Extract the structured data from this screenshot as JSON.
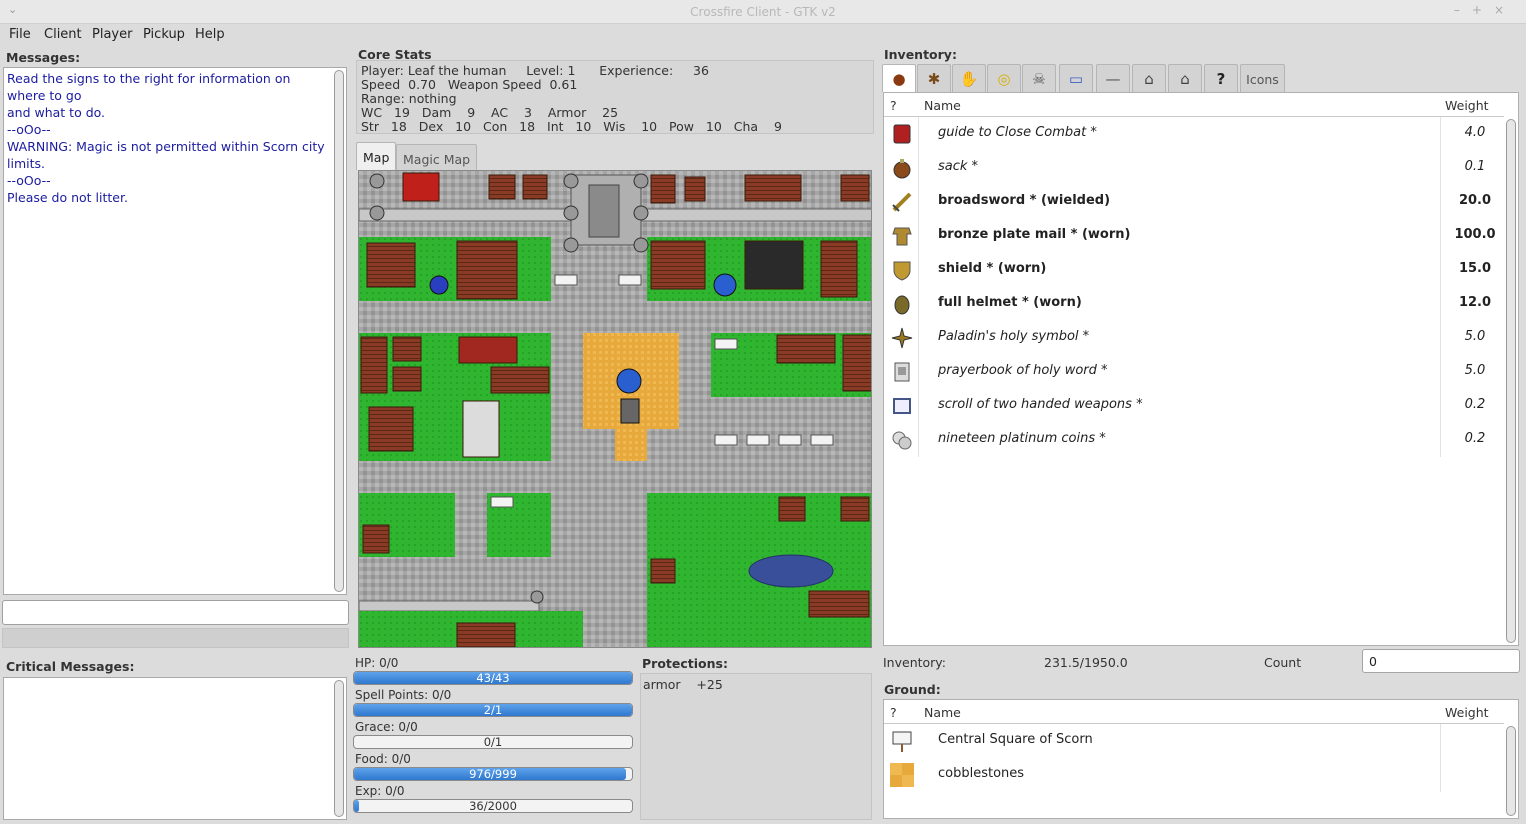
{
  "window": {
    "title": "Crossfire Client - GTK v2"
  },
  "menu": [
    "File",
    "Client",
    "Player",
    "Pickup",
    "Help"
  ],
  "messages": {
    "label": "Messages:",
    "lines": [
      "Read the signs to the right for information on where to go",
      "and what to do.",
      "--oOo--",
      "WARNING: Magic is not permitted within Scorn city limits.",
      "--oOo--",
      "Please do not litter."
    ]
  },
  "critical": {
    "label": "Critical Messages:"
  },
  "core_stats": {
    "label": "Core Stats",
    "rows": [
      "Player: Leaf the human     Level: 1      Experience:     36",
      "Speed  0.70   Weapon Speed  0.61",
      "Range: nothing",
      "WC   19   Dam    9    AC    3    Armor    25",
      "Str   18   Dex   10   Con   18   Int   10   Wis    10   Pow   10   Cha    9"
    ]
  },
  "map_tabs": [
    "Map",
    "Magic Map"
  ],
  "vitals": [
    {
      "label": "HP: 0/0",
      "text": "43/43",
      "fraction": 1.0
    },
    {
      "label": "Spell Points: 0/0",
      "text": "2/1",
      "fraction": 1.0
    },
    {
      "label": "Grace: 0/0",
      "text": "0/1",
      "fraction": 0.0
    },
    {
      "label": "Food: 0/0",
      "text": "976/999",
      "fraction": 0.977
    },
    {
      "label": "Exp: 0/0",
      "text": "36/2000",
      "fraction": 0.018
    }
  ],
  "protections": {
    "label": "Protections:",
    "lines": [
      "armor    +25"
    ]
  },
  "inventory": {
    "label": "Inventory:",
    "tab_icons": [
      "bag-icon",
      "bug-icon",
      "hands-icon",
      "coins-icon",
      "skull-icon",
      "scale-icon",
      "sword-icon",
      "lock-open-icon",
      "lock-icon",
      "help-icon"
    ],
    "icons_tab": "Icons",
    "help_glyph": "?",
    "columns": {
      "flag": "?",
      "name": "Name",
      "weight": "Weight"
    },
    "items": [
      {
        "icon": "book-icon",
        "name": "guide to Close Combat  *",
        "weight": "4.0",
        "style": "italic",
        "color": "#b02020"
      },
      {
        "icon": "sack-icon",
        "name": "sack  *",
        "weight": "0.1",
        "style": "italic",
        "color": "#8a4a1a"
      },
      {
        "icon": "sword-icon",
        "name": "broadsword  * (wielded)",
        "weight": "20.0",
        "style": "bold",
        "color": "#a08020"
      },
      {
        "icon": "armor-icon",
        "name": "bronze plate mail  * (worn)",
        "weight": "100.0",
        "style": "bold",
        "color": "#b08a30"
      },
      {
        "icon": "shield-icon",
        "name": "shield  * (worn)",
        "weight": "15.0",
        "style": "bold",
        "color": "#c09a30"
      },
      {
        "icon": "helmet-icon",
        "name": "full helmet  * (worn)",
        "weight": "12.0",
        "style": "bold",
        "color": "#7a6a2a"
      },
      {
        "icon": "holy-symbol-icon",
        "name": "Paladin's holy symbol  *",
        "weight": "5.0",
        "style": "italic",
        "color": "#9a7a20"
      },
      {
        "icon": "prayerbook-icon",
        "name": "prayerbook of holy word  *",
        "weight": "5.0",
        "style": "italic",
        "color": "#777"
      },
      {
        "icon": "scroll-icon",
        "name": "scroll of two handed weapons  *",
        "weight": "0.2",
        "style": "italic",
        "color": "#445588"
      },
      {
        "icon": "platinum-coins-icon",
        "name": "nineteen platinum coins  *",
        "weight": "0.2",
        "style": "italic",
        "color": "#bbb"
      }
    ],
    "weight_label": "Inventory:",
    "weight_value": "231.5/1950.0",
    "count_label": "Count",
    "count_value": "0"
  },
  "ground": {
    "label": "Ground:",
    "columns": {
      "flag": "?",
      "name": "Name",
      "weight": "Weight"
    },
    "items": [
      {
        "icon": "sign-icon",
        "name": "Central Square of Scorn",
        "weight": ""
      },
      {
        "icon": "cobblestones-icon",
        "name": "cobblestones",
        "weight": ""
      }
    ]
  }
}
